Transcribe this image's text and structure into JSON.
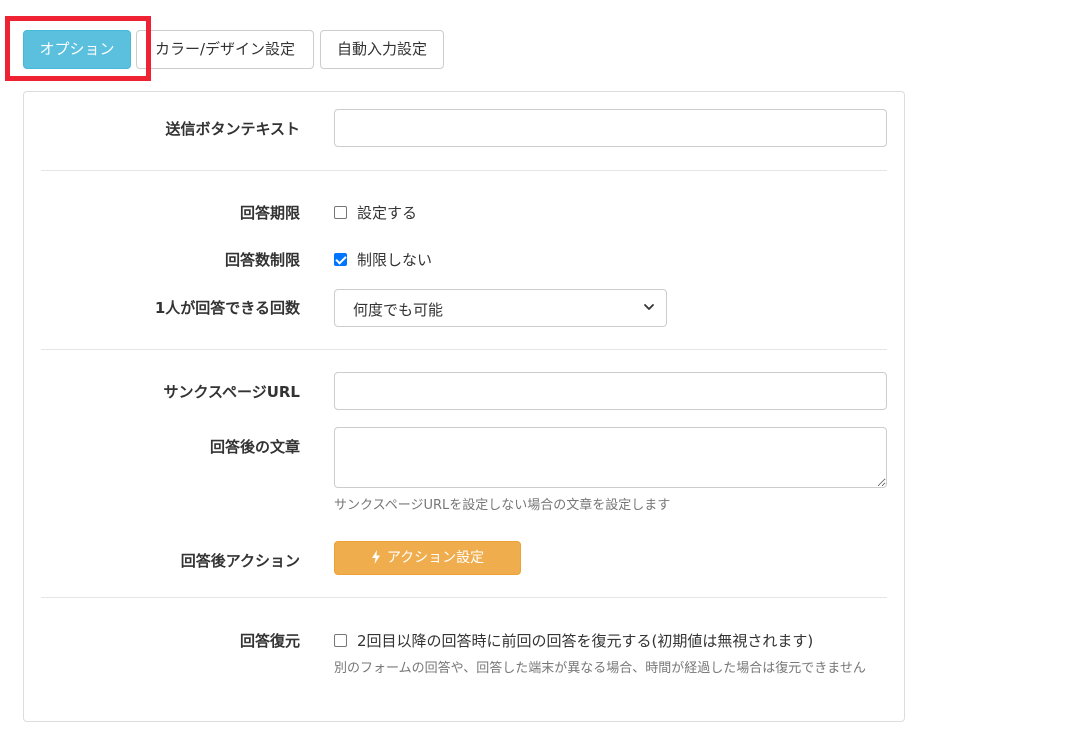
{
  "tabs": [
    {
      "label": "オプション",
      "active": true
    },
    {
      "label": "カラー/デザイン設定",
      "active": false
    },
    {
      "label": "自動入力設定",
      "active": false
    }
  ],
  "form": {
    "submit_text": {
      "label": "送信ボタンテキスト",
      "value": ""
    },
    "deadline": {
      "label": "回答期限",
      "checkbox_label": "設定する",
      "checked": false
    },
    "limit": {
      "label": "回答数制限",
      "checkbox_label": "制限しない",
      "checked": true
    },
    "per_person": {
      "label": "1人が回答できる回数",
      "selected": "何度でも可能"
    },
    "thanks_url": {
      "label": "サンクスページURL",
      "value": ""
    },
    "after_text": {
      "label": "回答後の文章",
      "value": "",
      "help": "サンクスページURLを設定しない場合の文章を設定します"
    },
    "after_action": {
      "label": "回答後アクション",
      "button_label": "アクション設定"
    },
    "restore": {
      "label": "回答復元",
      "checkbox_label": "2回目以降の回答時に前回の回答を復元する(初期値は無視されます)",
      "checked": false,
      "help": "別のフォームの回答や、回答した端末が異なる場合、時間が経過した場合は復元できません"
    }
  },
  "colors": {
    "active_tab": "#5bc0de",
    "highlight": "#ee2233",
    "action_button": "#f0ad4e",
    "checkbox_checked": "#0075ff"
  },
  "icons": {
    "action_icon": "bolt-icon",
    "select_icon": "chevron-down-icon"
  }
}
